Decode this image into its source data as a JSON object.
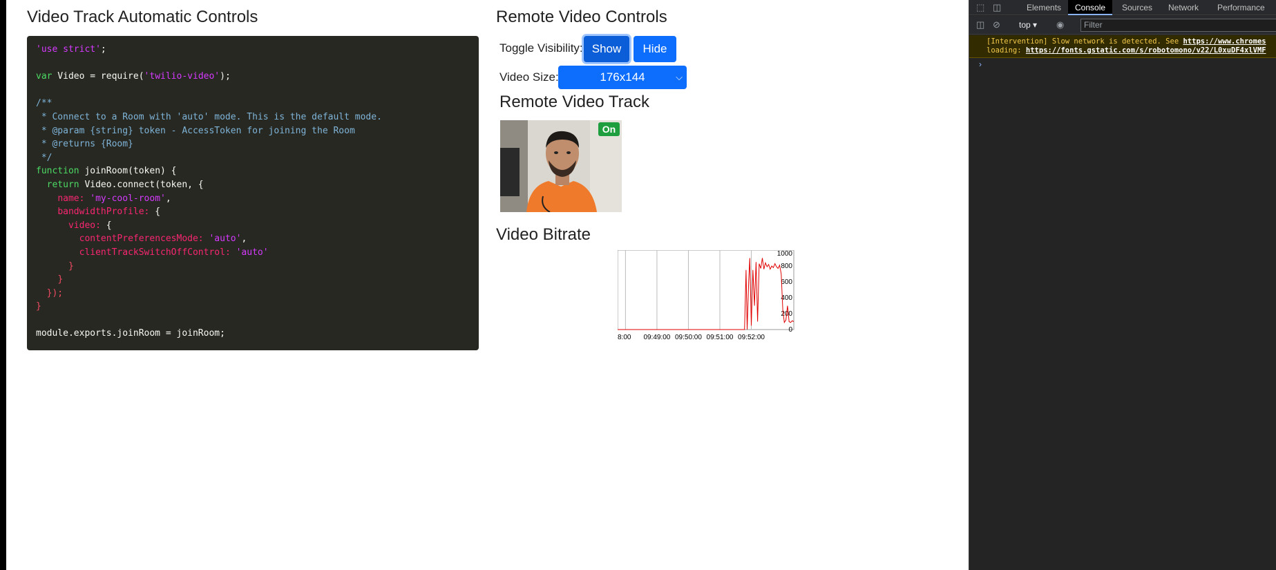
{
  "left_panel": {
    "title": "Video Track Automatic Controls"
  },
  "code_lines": [
    "'use strict';",
    "",
    "var Video = require('twilio-video');",
    "",
    "/**",
    " * Connect to a Room with 'auto' mode. This is the default mode.",
    " * @param {string} token - AccessToken for joining the Room",
    " * @returns {Room}",
    " */",
    "function joinRoom(token) {",
    "  return Video.connect(token, {",
    "    name: 'my-cool-room',",
    "    bandwidthProfile: {",
    "      video: {",
    "        contentPreferencesMode: 'auto',",
    "        clientTrackSwitchOffControl: 'auto'",
    "      }",
    "    }",
    "  });",
    "}",
    "",
    "module.exports.joinRoom = joinRoom;"
  ],
  "right_panel": {
    "title": "Remote Video Controls",
    "toggle_label": "Toggle Visibility:",
    "show_button": "Show",
    "hide_button": "Hide",
    "size_label": "Video Size:",
    "size_value": "176x144",
    "track_title": "Remote Video Track",
    "badge": "On",
    "bitrate_title": "Video Bitrate"
  },
  "chart_data": {
    "type": "line",
    "title": "",
    "xlabel": "",
    "ylabel": "",
    "x_ticks": [
      "8:00",
      "09:49:00",
      "09:50:00",
      "09:51:00",
      "09:52:00"
    ],
    "y_ticks": [
      0,
      200,
      400,
      600,
      800,
      1000
    ],
    "ylim": [
      0,
      1000
    ],
    "grid": "vertical",
    "series": [
      {
        "color": "#e00000",
        "x": [
          "09:47:45",
          "09:48:30",
          "09:49:30",
          "09:50:30",
          "09:51:30",
          "09:51:45",
          "09:51:47",
          "09:51:50",
          "09:51:52",
          "09:51:55",
          "09:51:57",
          "09:52:00",
          "09:52:03",
          "09:52:06",
          "09:52:09",
          "09:52:12",
          "09:52:15",
          "09:52:18",
          "09:52:21",
          "09:52:24",
          "09:52:27",
          "09:52:30",
          "09:52:33",
          "09:52:36",
          "09:52:39",
          "09:52:42",
          "09:52:45",
          "09:52:48",
          "09:52:51",
          "09:52:54",
          "09:52:57",
          "09:53:00",
          "09:53:03",
          "09:53:06",
          "09:53:09",
          "09:53:12",
          "09:53:15",
          "09:53:18",
          "09:53:21"
        ],
        "values": [
          0,
          0,
          0,
          0,
          0,
          0,
          0,
          750,
          0,
          600,
          900,
          50,
          750,
          300,
          850,
          100,
          830,
          770,
          900,
          760,
          840,
          790,
          820,
          760,
          800,
          780,
          830,
          790,
          770,
          810,
          700,
          250,
          90,
          120,
          300,
          100,
          90,
          110,
          100
        ]
      }
    ]
  },
  "devtools": {
    "tabs": [
      "Elements",
      "Console",
      "Sources",
      "Network",
      "Performance"
    ],
    "active_tab": "Console",
    "context": "top",
    "filter_placeholder": "Filter",
    "warning_line1": "[Intervention] Slow network is detected. See ",
    "warning_url1": "https://www.chromes",
    "warning_line2": "loading: ",
    "warning_url2": "https://fonts.gstatic.com/s/robotomono/v22/L0xuDF4xlVMF"
  }
}
